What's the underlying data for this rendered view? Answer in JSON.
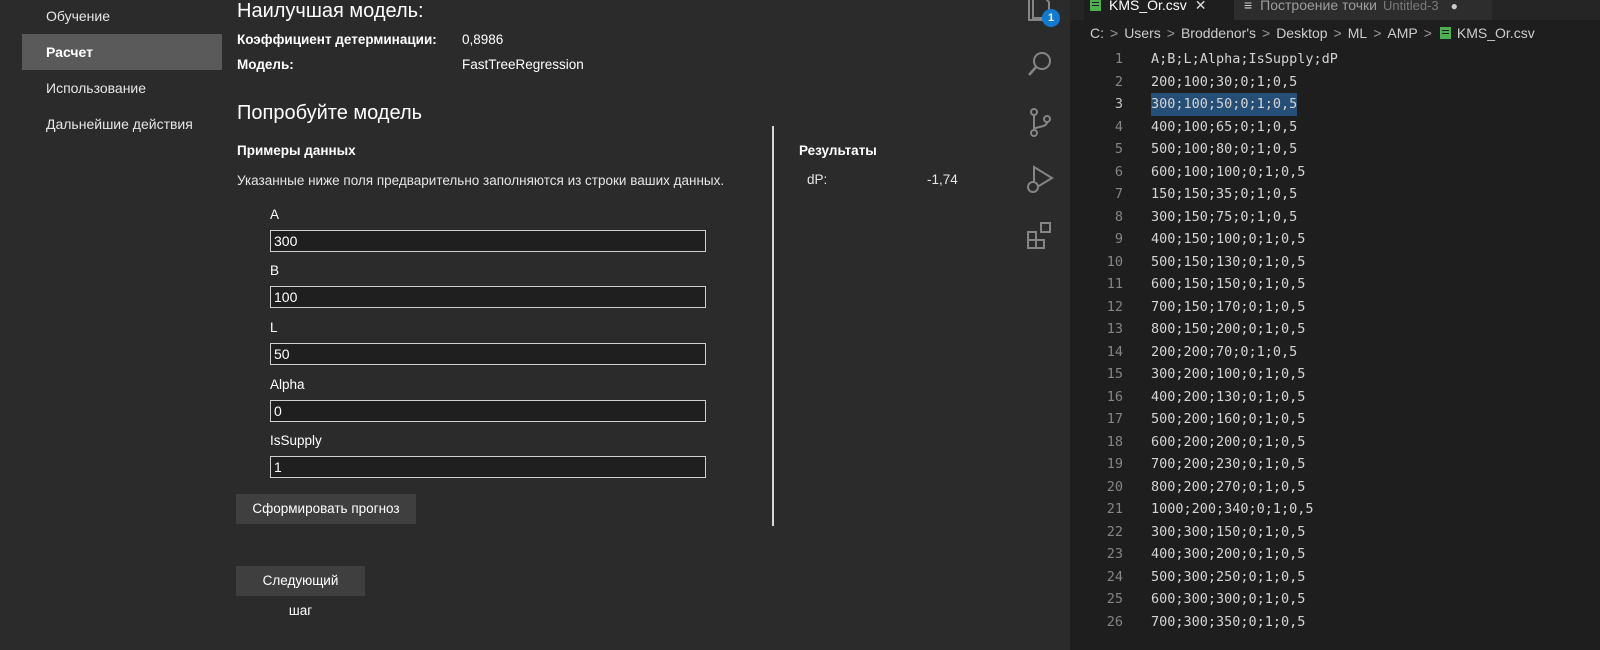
{
  "sidebar": {
    "items": [
      {
        "label": "Обучение",
        "active": false
      },
      {
        "label": "Расчет",
        "active": true
      },
      {
        "label": "Использование",
        "active": false
      },
      {
        "label": "Дальнейшие действия",
        "active": false
      }
    ]
  },
  "best_model": {
    "title": "Наилучшая модель:",
    "r2_label": "Коэффициент детерминации:",
    "r2_value": "0,8986",
    "model_label": "Модель:",
    "model_value": "FastTreeRegression"
  },
  "try_model": {
    "title": "Попробуйте модель",
    "samples_title": "Примеры данных",
    "samples_desc": "Указанные ниже поля предварительно заполняются из строки ваших данных.",
    "fields": [
      {
        "label": "A",
        "value": "300"
      },
      {
        "label": "B",
        "value": "100"
      },
      {
        "label": "L",
        "value": "50"
      },
      {
        "label": "Alpha",
        "value": "0"
      },
      {
        "label": "IsSupply",
        "value": "1"
      }
    ],
    "predict_button": "Сформировать прогноз",
    "results_title": "Результаты",
    "result_name": "dP:",
    "result_value": "-1,74"
  },
  "next_button": "Следующий шаг",
  "activity_bar": {
    "icons": [
      "explorer-icon",
      "search-icon",
      "source-control-icon",
      "run-debug-icon",
      "extensions-icon"
    ],
    "badge": "1",
    "badge_color": "#0e7ad1"
  },
  "editor": {
    "tabs": [
      {
        "label": "KMS_Or.csv",
        "icon": "csv-file-icon",
        "active": true
      },
      {
        "label": "Построение точки",
        "sub": "Untitled-3",
        "icon": "text-file-icon",
        "active": false
      }
    ],
    "breadcrumb": [
      "C:",
      "Users",
      "Broddenor's",
      "Desktop",
      "ML",
      "AMP",
      "KMS_Or.csv"
    ],
    "selection_color": "#264f78",
    "current_line": 3,
    "lines": [
      "A;B;L;Alpha;IsSupply;dP",
      "200;100;30;0;1;0,5",
      "300;100;50;0;1;0,5",
      "400;100;65;0;1;0,5",
      "500;100;80;0;1;0,5",
      "600;100;100;0;1;0,5",
      "150;150;35;0;1;0,5",
      "300;150;75;0;1;0,5",
      "400;150;100;0;1;0,5",
      "500;150;130;0;1;0,5",
      "600;150;150;0;1;0,5",
      "700;150;170;0;1;0,5",
      "800;150;200;0;1;0,5",
      "200;200;70;0;1;0,5",
      "300;200;100;0;1;0,5",
      "400;200;130;0;1;0,5",
      "500;200;160;0;1;0,5",
      "600;200;200;0;1;0,5",
      "700;200;230;0;1;0,5",
      "800;200;270;0;1;0,5",
      "1000;200;340;0;1;0,5",
      "300;300;150;0;1;0,5",
      "400;300;200;0;1;0,5",
      "500;300;250;0;1;0,5",
      "600;300;300;0;1;0,5",
      "700;300;350;0;1;0,5"
    ]
  }
}
